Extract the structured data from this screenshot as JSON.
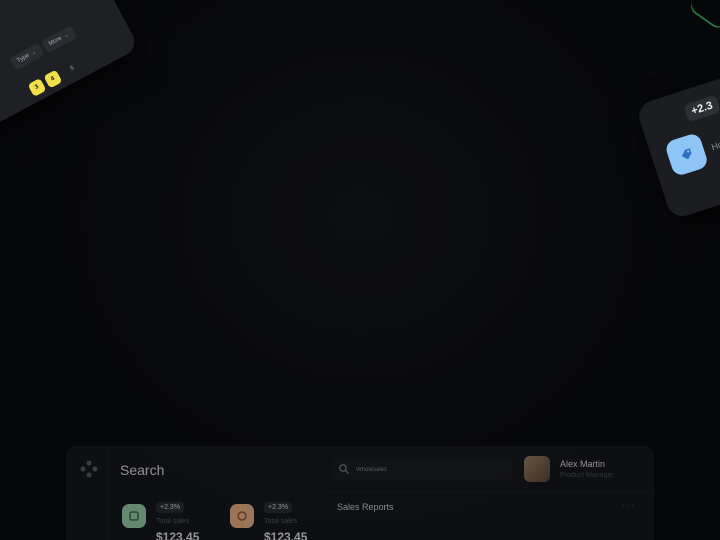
{
  "top_left_card": {
    "filter_type_label": "Type",
    "filter_more_label": "More",
    "pagination": [
      {
        "label": "3",
        "active": true
      },
      {
        "label": "4",
        "active": true
      },
      {
        "label": "5",
        "active": false
      }
    ],
    "accent_color": "#f2e04a"
  },
  "right_card": {
    "change_badge": "+2.3",
    "label_partial": "Ho",
    "icon_color": "#8fc4f6",
    "icon": "tag-icon"
  },
  "dashboard": {
    "search_title": "Search",
    "search_placeholder": "Wholesales",
    "user": {
      "name": "Alex Martin",
      "role": "Product Manager"
    },
    "stats": [
      {
        "badge": "+2.3%",
        "caption": "Total sales",
        "amount": "$123.45",
        "icon": "cart-icon",
        "icon_color": "#9fd8b0"
      },
      {
        "badge": "+2.3%",
        "caption": "Total sales",
        "amount": "$123.45",
        "icon": "box-icon",
        "icon_color": "#f5b98a"
      }
    ],
    "sales_reports_label": "Sales Reports",
    "more_label": "···"
  }
}
